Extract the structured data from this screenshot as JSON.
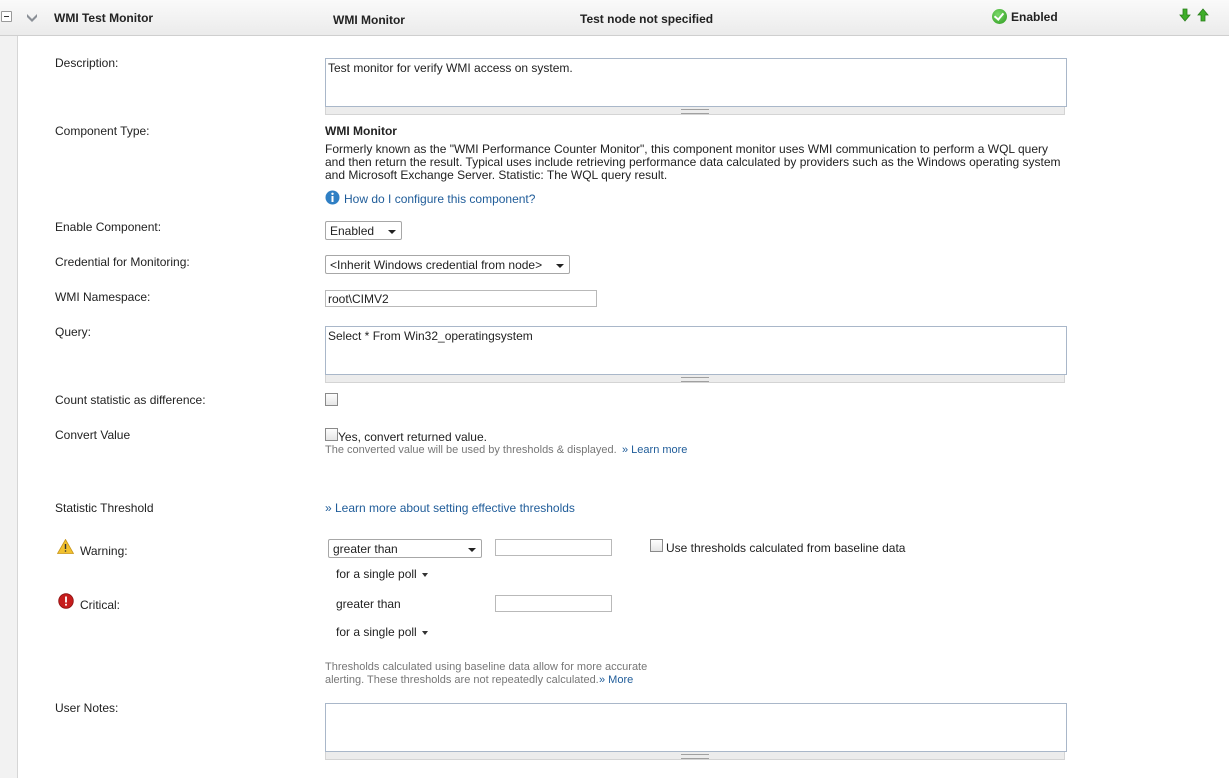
{
  "header": {
    "monitor_name": "WMI Test Monitor",
    "monitor_type": "WMI Monitor",
    "node": "Test node not specified",
    "status": "Enabled"
  },
  "description": {
    "label": "Description:",
    "value": "Test monitor for verify WMI access on system."
  },
  "component_type": {
    "label": "Component Type:",
    "name": "WMI Monitor",
    "text": "Formerly known as the \"WMI Performance Counter Monitor\", this component monitor uses WMI communication to perform a WQL query and then return the result. Typical uses include retrieving performance data calculated by providers such as the Windows operating system and Microsoft Exchange Server. Statistic: The WQL query result.",
    "help_link": "How do I configure this component?"
  },
  "enable_component": {
    "label": "Enable Component:",
    "value": "Enabled"
  },
  "credential": {
    "label": "Credential for Monitoring:",
    "value": "<Inherit Windows credential from node>"
  },
  "namespace": {
    "label": "WMI Namespace:",
    "value": "root\\CIMV2"
  },
  "query": {
    "label": "Query:",
    "value": "Select * From Win32_operatingsystem"
  },
  "count_difference": {
    "label": "Count statistic as difference:"
  },
  "convert_value": {
    "label": "Convert Value",
    "checkbox_label": "Yes, convert returned value.",
    "hint": "The converted value will be used by thresholds & displayed.",
    "learn_more": "» Learn more"
  },
  "threshold": {
    "label": "Statistic Threshold",
    "learn_link": "» Learn more about setting effective thresholds",
    "warning_label": "Warning:",
    "warning_operator": "greater than",
    "warning_poll": "for a single poll",
    "baseline_label": "Use thresholds calculated from baseline data",
    "critical_label": "Critical:",
    "critical_operator": "greater than",
    "critical_poll": "for a single poll",
    "baseline_note_1": "Thresholds calculated using baseline data allow  for more accurate",
    "baseline_note_2": "alerting. These thresholds are not repeatedly calculated.",
    "more_link": "» More"
  },
  "user_notes": {
    "label": "User Notes:",
    "value": ""
  },
  "colors": {
    "link": "#1f5c99",
    "ok": "#2d9a1f",
    "arrow": "#3fae2a"
  }
}
